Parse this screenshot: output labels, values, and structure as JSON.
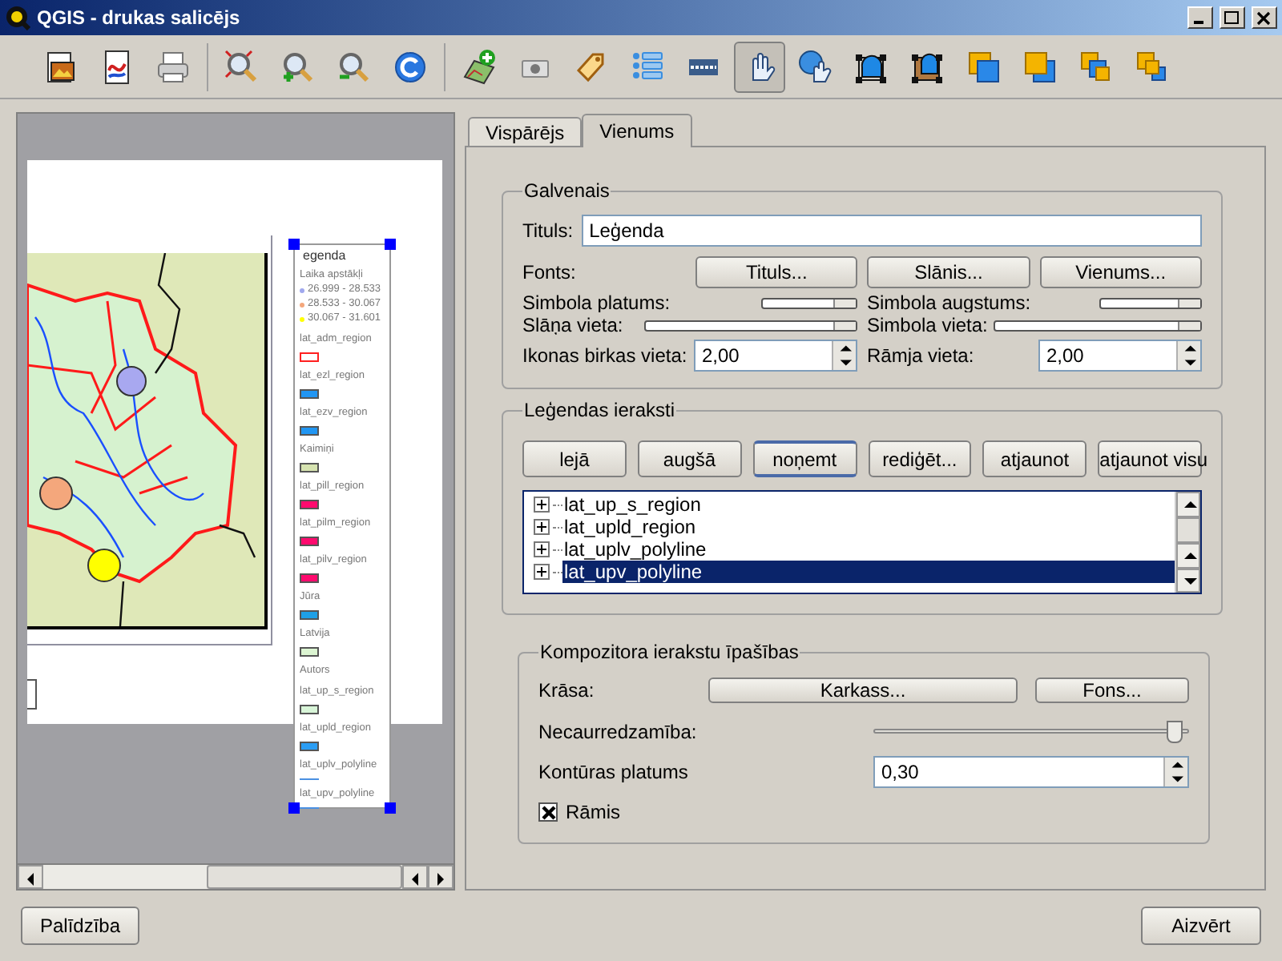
{
  "window": {
    "title": "QGIS - drukas salicējs"
  },
  "toolbar": [
    {
      "kind": "export-image",
      "pressed": false
    },
    {
      "kind": "export-svg",
      "pressed": false
    },
    {
      "kind": "print",
      "pressed": false
    },
    {
      "kind": "sep"
    },
    {
      "kind": "zoom-full",
      "pressed": false
    },
    {
      "kind": "zoom-in",
      "pressed": false
    },
    {
      "kind": "zoom-out",
      "pressed": false
    },
    {
      "kind": "refresh",
      "pressed": false
    },
    {
      "kind": "sep"
    },
    {
      "kind": "add-map",
      "pressed": false
    },
    {
      "kind": "add-image",
      "pressed": false
    },
    {
      "kind": "add-label",
      "pressed": false
    },
    {
      "kind": "add-legend",
      "pressed": false
    },
    {
      "kind": "add-scalebar",
      "pressed": false
    },
    {
      "kind": "select",
      "pressed": true
    },
    {
      "kind": "move-content",
      "pressed": false
    },
    {
      "kind": "group",
      "pressed": false
    },
    {
      "kind": "ungroup",
      "pressed": false
    },
    {
      "kind": "raise",
      "pressed": false
    },
    {
      "kind": "lower",
      "pressed": false
    },
    {
      "kind": "top",
      "pressed": false
    },
    {
      "kind": "bottom",
      "pressed": false
    }
  ],
  "composition": {
    "legend": {
      "title": "egenda",
      "group": "Laika apstākļi",
      "classes": [
        {
          "label": "26.999 - 28.533",
          "color": "#a0a8ee"
        },
        {
          "label": "28.533 - 30.067",
          "color": "#f4a77c"
        },
        {
          "label": "30.067 - 31.601",
          "color": "#ffff00"
        }
      ],
      "layers": [
        {
          "label": "lat_adm_region",
          "kind": "outline",
          "color": "#ff2020"
        },
        {
          "label": "lat_ezl_region",
          "kind": "fill",
          "color": "#2196f3"
        },
        {
          "label": "lat_ezv_region",
          "kind": "fill",
          "color": "#2196f3"
        },
        {
          "label": "Kaimiņi",
          "kind": "fill",
          "color": "#d6e3b0"
        },
        {
          "label": "lat_pill_region",
          "kind": "fill",
          "color": "#ff0a6e"
        },
        {
          "label": "lat_pilm_region",
          "kind": "fill",
          "color": "#ff0a6e"
        },
        {
          "label": "lat_pilv_region",
          "kind": "fill",
          "color": "#ff0a6e"
        },
        {
          "label": "Jūra",
          "kind": "fill",
          "color": "#1ea0e6"
        },
        {
          "label": "Latvija",
          "kind": "fill",
          "color": "#dcf5d2"
        },
        {
          "label": "Autors",
          "kind": "none"
        },
        {
          "label": "lat_up_s_region",
          "kind": "fill",
          "color": "#d8f5d8"
        },
        {
          "label": "lat_upld_region",
          "kind": "fill",
          "color": "#2a9df4"
        },
        {
          "label": "lat_uplv_polyline",
          "kind": "line",
          "color": "#4a90e2"
        },
        {
          "label": "lat_upv_polyline",
          "kind": "line",
          "color": "#4a90e2"
        }
      ]
    }
  },
  "tabs": [
    {
      "label": "Vispārējs",
      "selected": false
    },
    {
      "label": "Vienums",
      "selected": true
    }
  ],
  "main": {
    "title": "Galvenais",
    "title_label": "Tituls:",
    "title_value": "Leģenda",
    "fonts_label": "Fonts:",
    "font_buttons": [
      "Tituls...",
      "Slānis...",
      "Vienums..."
    ],
    "compact_rows": [
      [
        "Simbola platums:",
        "Simbola augstums:"
      ],
      [
        "Slāņa vieta:",
        "Simbola vieta:"
      ]
    ],
    "spin_fields": [
      {
        "label": "Ikonas birkas vieta:",
        "value": "2,00"
      },
      {
        "label": "Rāmja vieta:",
        "value": "2,00"
      }
    ]
  },
  "entries": {
    "title": "Leģendas ieraksti",
    "buttons": [
      {
        "label": "lejā",
        "hovered": false
      },
      {
        "label": "augšā",
        "hovered": false
      },
      {
        "label": "noņemt",
        "hovered": true
      },
      {
        "label": "rediģēt...",
        "hovered": false
      },
      {
        "label": "atjaunot",
        "hovered": false
      },
      {
        "label": "atjaunot visu",
        "hovered": false
      }
    ],
    "items": [
      {
        "label": "lat_up_s_region",
        "selected": false
      },
      {
        "label": "lat_upld_region",
        "selected": false
      },
      {
        "label": "lat_uplv_polyline",
        "selected": false
      },
      {
        "label": "lat_upv_polyline",
        "selected": true
      }
    ]
  },
  "item_props": {
    "title": "Kompozitora ierakstu īpašības",
    "color_label": "Krāsa:",
    "color_buttons": [
      "Karkass...",
      "Fons..."
    ],
    "opacity_label": "Necaurredzamība:",
    "opacity": {
      "level": 0.98
    },
    "outline_label": "Kontūras platums",
    "outline_value": "0,30",
    "frame": {
      "label": "Rāmis",
      "checked": true
    }
  },
  "footer": {
    "help": "Palīdzība",
    "close": "Aizvērt"
  }
}
